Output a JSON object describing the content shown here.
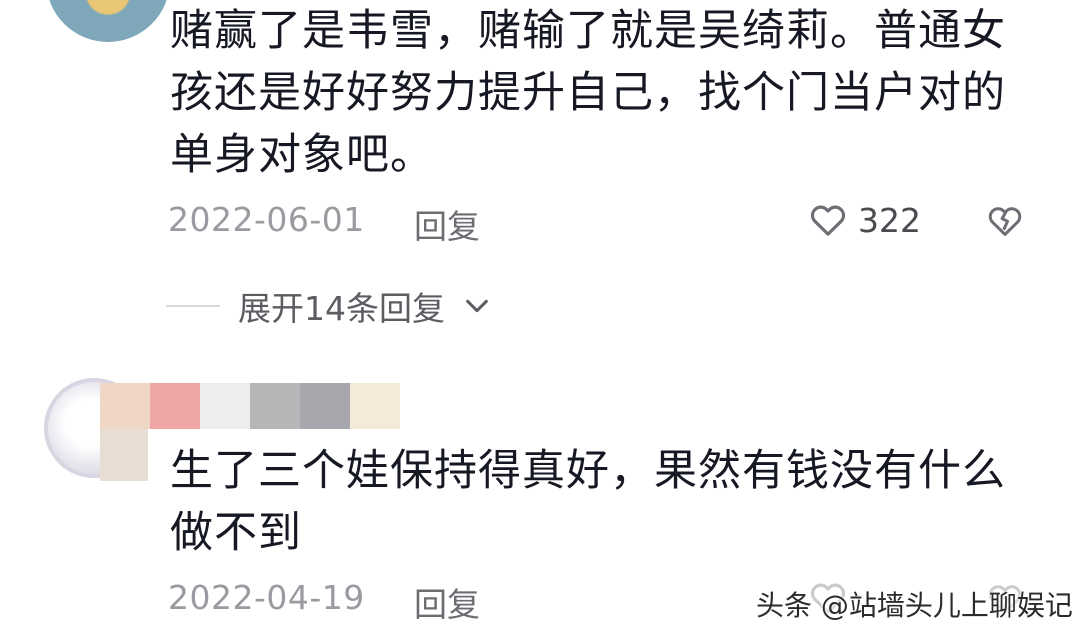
{
  "comments": [
    {
      "text": "赌赢了是韦雪，赌输了就是吴绮莉。普通女孩还是好好努力提升自己，找个门当户对的单身对象吧。",
      "date": "2022-06-01",
      "reply_label": "回复",
      "likes": "322",
      "expand_label": "展开14条回复"
    },
    {
      "text": "生了三个娃保持得真好，果然有钱没有什么做不到",
      "date": "2022-04-19",
      "reply_label": "回复"
    }
  ],
  "censor_colors": [
    "#f0d6c4",
    "#eea6a6",
    "#ededed",
    "#b6b6b8",
    "#a8a7ad",
    "#f3ead7"
  ],
  "watermark": "头条 @站墙头儿上聊娱记",
  "icons": {
    "like": "heart-outline-icon",
    "dislike": "broken-heart-icon",
    "expand": "chevron-down-icon"
  }
}
